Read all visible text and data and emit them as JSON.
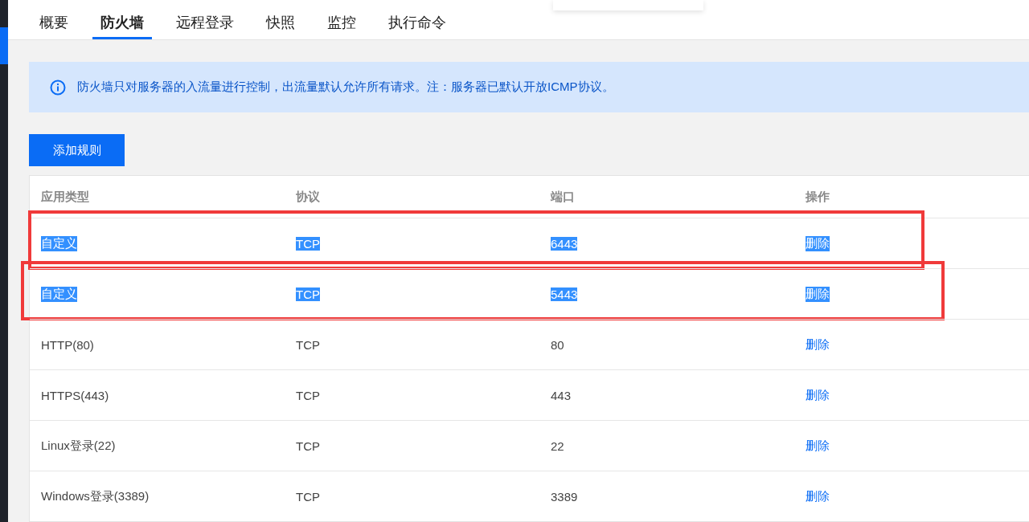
{
  "tabs": [
    {
      "label": "概要",
      "selected": false
    },
    {
      "label": "防火墙",
      "selected": true
    },
    {
      "label": "远程登录",
      "selected": false
    },
    {
      "label": "快照",
      "selected": false
    },
    {
      "label": "监控",
      "selected": false
    },
    {
      "label": "执行命令",
      "selected": false
    }
  ],
  "notice": "防火墙只对服务器的入流量进行控制，出流量默认允许所有请求。注：服务器已默认开放ICMP协议。",
  "add_button": "添加规则",
  "table": {
    "columns": [
      "应用类型",
      "协议",
      "端口",
      "操作"
    ],
    "rows": [
      {
        "app": "自定义",
        "protocol": "TCP",
        "port": "6443",
        "action": "删除",
        "selected": true,
        "outlined": true
      },
      {
        "app": "自定义",
        "protocol": "TCP",
        "port": "5443",
        "action": "删除",
        "selected": true,
        "outlined": true
      },
      {
        "app": "HTTP(80)",
        "protocol": "TCP",
        "port": "80",
        "action": "删除",
        "selected": false,
        "outlined": false
      },
      {
        "app": "HTTPS(443)",
        "protocol": "TCP",
        "port": "443",
        "action": "删除",
        "selected": false,
        "outlined": false
      },
      {
        "app": "Linux登录(22)",
        "protocol": "TCP",
        "port": "22",
        "action": "删除",
        "selected": false,
        "outlined": false
      },
      {
        "app": "Windows登录(3389)",
        "protocol": "TCP",
        "port": "3389",
        "action": "删除",
        "selected": false,
        "outlined": false
      }
    ]
  }
}
